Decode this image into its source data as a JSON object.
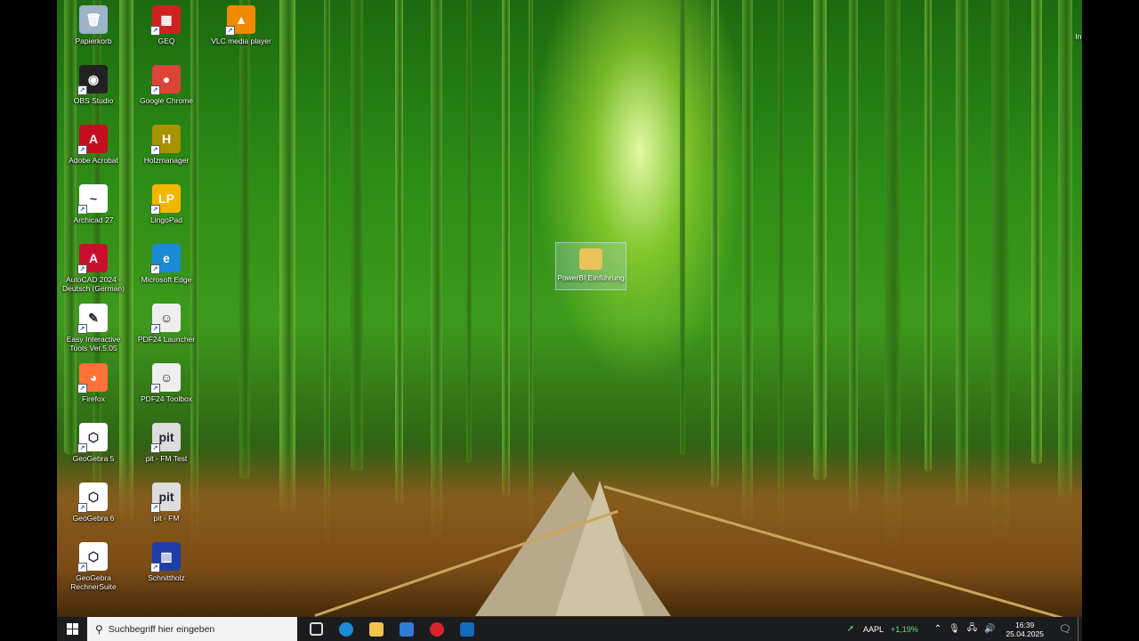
{
  "desktop": {
    "icons": [
      {
        "label": "Papierkorb",
        "glyph": "🗑",
        "color": "#9db3c8",
        "icon": "recycle-bin-icon"
      },
      {
        "label": "GEQ",
        "glyph": "▦",
        "color": "#d02020",
        "icon": "geq-icon"
      },
      {
        "label": "VLC media player",
        "glyph": "▲",
        "color": "#f08a00",
        "icon": "vlc-icon"
      },
      {
        "label": "OBS Studio",
        "glyph": "◉",
        "color": "#222",
        "icon": "obs-icon"
      },
      {
        "label": "Google Chrome",
        "glyph": "●",
        "color": "#db4437",
        "icon": "chrome-icon"
      },
      {
        "label": "Adobe Acrobat",
        "glyph": "A",
        "color": "#c50f1f",
        "icon": "acrobat-icon"
      },
      {
        "label": "Holzmanager",
        "glyph": "H",
        "color": "#a89400",
        "icon": "holzmanager-icon"
      },
      {
        "label": "Archicad 27",
        "glyph": "~",
        "color": "#fff",
        "icon": "archicad-icon"
      },
      {
        "label": "LingoPad",
        "glyph": "LP",
        "color": "#f2b600",
        "icon": "lingopad-icon"
      },
      {
        "label": "AutoCAD 2024 - Deutsch (German)",
        "glyph": "A",
        "color": "#c8102e",
        "icon": "autocad-icon"
      },
      {
        "label": "Microsoft Edge",
        "glyph": "e",
        "color": "#1a8bd4",
        "icon": "edge-icon"
      },
      {
        "label": "Easy Interactive Tools Ver.5.05",
        "glyph": "✎",
        "color": "#fff",
        "icon": "easy-interactive-icon"
      },
      {
        "label": "PDF24 Launcher",
        "glyph": "☺",
        "color": "#eee",
        "icon": "pdf24-launcher-icon"
      },
      {
        "label": "Firefox",
        "glyph": "◕",
        "color": "#ff7139",
        "icon": "firefox-icon"
      },
      {
        "label": "PDF24 Toolbox",
        "glyph": "☺",
        "color": "#eee",
        "icon": "pdf24-toolbox-icon"
      },
      {
        "label": "GeoGebra 5",
        "glyph": "⬡",
        "color": "#fff",
        "icon": "geogebra-5-icon"
      },
      {
        "label": "pit - FM Test",
        "glyph": "pit",
        "color": "#ddd",
        "icon": "pit-fm-test-icon"
      },
      {
        "label": "GeoGebra 6",
        "glyph": "⬡",
        "color": "#fff",
        "icon": "geogebra-6-icon"
      },
      {
        "label": "pit - FM",
        "glyph": "pit",
        "color": "#ddd",
        "icon": "pit-fm-icon"
      },
      {
        "label": "GeoGebra RechnerSuite",
        "glyph": "⬡",
        "color": "#fff",
        "icon": "geogebra-suite-icon"
      },
      {
        "label": "Schnittholz",
        "glyph": "▥",
        "color": "#1f3fa8",
        "icon": "schnittholz-icon"
      }
    ],
    "dragged_icon": {
      "label": "PowerBI Einführung",
      "icon": "folder-icon"
    },
    "info_button": {
      "label": "Informationen zu diesem Bild",
      "icon": "camera-icon"
    }
  },
  "taskbar": {
    "start_icon": "windows-start-icon",
    "search_placeholder": "Suchbegriff hier eingeben",
    "apps": [
      {
        "name": "task-view",
        "color": "#dddddd"
      },
      {
        "name": "edge",
        "color": "#1a8bd4"
      },
      {
        "name": "file-explorer",
        "color": "#f3c44b"
      },
      {
        "name": "store",
        "color": "#2f7bd8"
      },
      {
        "name": "obs",
        "color": "#d8242c"
      },
      {
        "name": "outlook",
        "color": "#0f6cbd"
      }
    ],
    "stock": {
      "symbol": "AAPL",
      "change": "+1,19%"
    },
    "time": "16:39",
    "date": "25.04.2025"
  }
}
